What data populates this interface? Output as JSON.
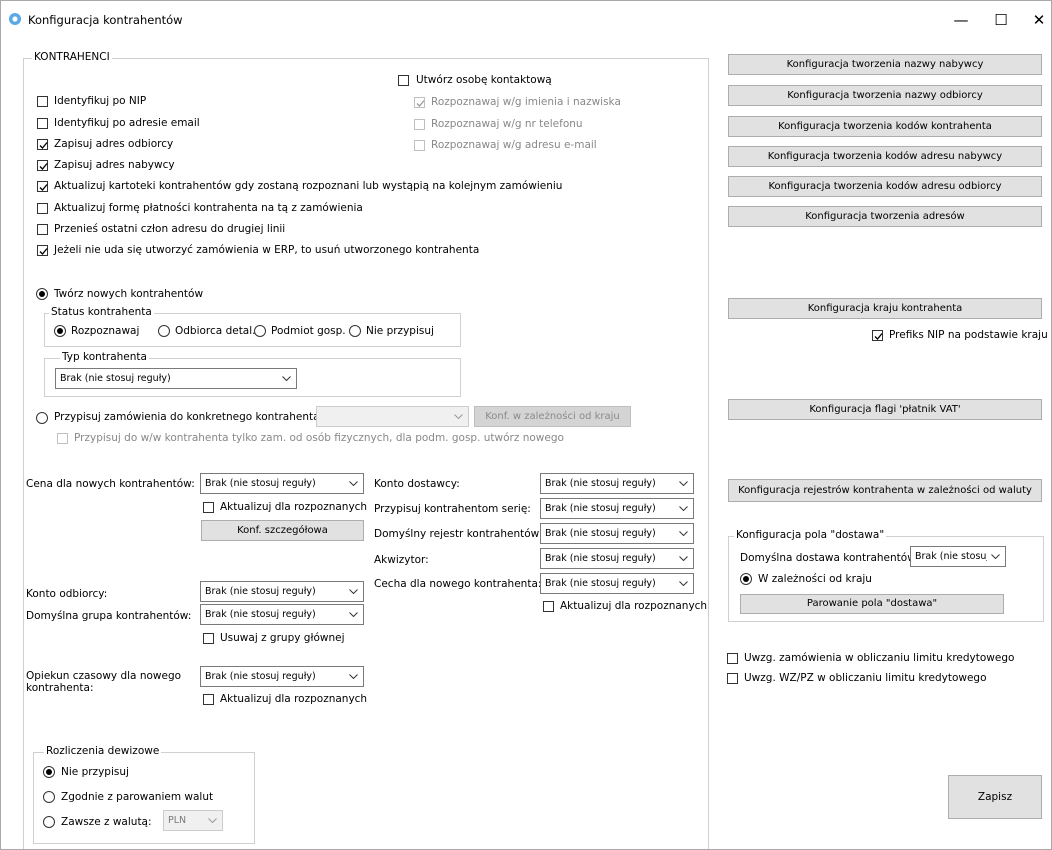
{
  "window": {
    "title": "Konfiguracja kontrahentów",
    "minimize": "—",
    "maximize": "☐",
    "close": "✕"
  },
  "kontrahenci": {
    "group_title": "KONTRAHENCI",
    "checks": [
      {
        "label": "Identyfikuj po NIP",
        "checked": false
      },
      {
        "label": "Identyfikuj po adresie email",
        "checked": false
      },
      {
        "label": "Zapisuj adres odbiorcy",
        "checked": true
      },
      {
        "label": "Zapisuj adres nabywcy",
        "checked": true
      },
      {
        "label": "Aktualizuj kartoteki kontrahentów gdy zostaną rozpoznani lub wystąpią na kolejnym zamówieniu",
        "checked": true
      },
      {
        "label": "Aktualizuj formę płatności kontrahenta na tą z zamówienia",
        "checked": false
      },
      {
        "label": "Przenieś ostatni człon adresu do drugiej linii",
        "checked": false
      },
      {
        "label": "Jeżeli nie uda się utworzyć zamówienia w ERP, to usuń utworzonego kontrahenta",
        "checked": true
      }
    ],
    "osoba": {
      "label": "Utwórz osobę kontaktową",
      "sub": [
        "Rozpoznawaj w/g imienia i nazwiska",
        "Rozpoznawaj w/g nr telefonu",
        "Rozpoznawaj w/g adresu e-mail"
      ]
    },
    "tworz_label": "Twórz nowych kontrahentów",
    "status": {
      "title": "Status kontrahenta",
      "options": [
        "Rozpoznawaj",
        "Odbiorca detal.",
        "Podmiot gosp.",
        "Nie przypisuj"
      ]
    },
    "typ": {
      "title": "Typ kontrahenta",
      "value": "Brak (nie stosuj reguły)"
    },
    "przypisuj_label": "Przypisuj zamówienia do konkretnego kontrahenta:",
    "przypisuj_combo": "",
    "konf_kraj_button": "Konf. w zależności od kraju",
    "przypisuj_sub": "Przypisuj do w/w kontrahenta tylko zam. od osób fizycznych, dla podm. gosp. utwórz nowego"
  },
  "form": {
    "cena_label": "Cena dla nowych kontrahentów:",
    "cena_value": "Brak (nie stosuj reguły)",
    "aktualizuj_rozp": "Aktualizuj dla rozpoznanych",
    "konf_szczeg": "Konf. szczegółowa",
    "konto_odbiorcy_label": "Konto odbiorcy:",
    "konto_odbiorcy_value": "Brak (nie stosuj reguły)",
    "grupa_label": "Domyślna grupa kontrahentów:",
    "grupa_value": "Brak (nie stosuj reguły)",
    "usuwaj_grupy": "Usuwaj z grupy głównej",
    "opiekun_label1": "Opiekun czasowy dla nowego",
    "opiekun_label2": "kontrahenta:",
    "opiekun_value": "Brak (nie stosuj reguły)",
    "konto_dostawcy_label": "Konto dostawcy:",
    "konto_dostawcy_value": "Brak (nie stosuj reguły)",
    "seria_label": "Przypisuj kontrahentom serię:",
    "seria_value": "Brak (nie stosuj reguły)",
    "rejestr_label": "Domyślny rejestr kontrahentów:",
    "rejestr_value": "Brak (nie stosuj reguły)",
    "akwizytor_label": "Akwizytor:",
    "akwizytor_value": "Brak (nie stosuj reguły)",
    "cecha_label": "Cecha dla nowego kontrahenta:",
    "cecha_value": "Brak (nie stosuj reguły)"
  },
  "dewizowe": {
    "title": "Rozliczenia dewizowe",
    "options": [
      "Nie przypisuj",
      "Zgodnie z parowaniem walut",
      "Zawsze z walutą:"
    ],
    "waluta": "PLN"
  },
  "right": {
    "buttons": [
      "Konfiguracja tworzenia nazwy nabywcy",
      "Konfiguracja tworzenia nazwy odbiorcy",
      "Konfiguracja tworzenia kodów kontrahenta",
      "Konfiguracja tworzenia kodów adresu nabywcy",
      "Konfiguracja tworzenia kodów adresu odbiorcy",
      "Konfiguracja tworzenia adresów"
    ],
    "kraj_button": "Konfiguracja kraju kontrahenta",
    "prefiks": "Prefiks NIP na podstawie kraju",
    "flagi_button": "Konfiguracja flagi 'płatnik VAT'",
    "rejestry_button": "Konfiguracja rejestrów kontrahenta w zależności od waluty",
    "dostawa": {
      "title": "Konfiguracja pola \"dostawa\"",
      "label": "Domyślna dostawa kontrahentów:",
      "value": "Brak (nie stosuj re",
      "radio": "W zależności od kraju",
      "button": "Parowanie pola \"dostawa\""
    },
    "limit1": "Uwzg. zamówienia w obliczaniu limitu kredytowego",
    "limit2": "Uwzg. WZ/PZ w obliczaniu limitu kredytowego",
    "save": "Zapisz"
  }
}
